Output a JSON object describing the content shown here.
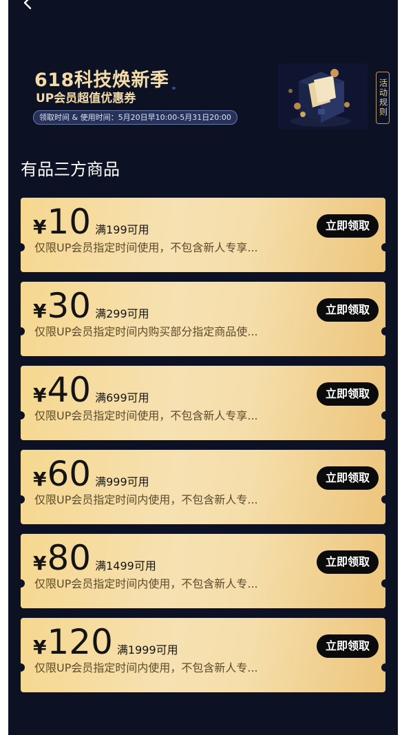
{
  "banner": {
    "title": "618科技焕新季",
    "subtitle": "UP会员超值优惠券",
    "time": "领取时间 & 使用时间：5月20日早10:00-5月31日20:00",
    "rules_label": "活动规则"
  },
  "section": {
    "title": "有品三方商品"
  },
  "coupons": [
    {
      "currency": "¥",
      "value": "10",
      "condition": "满199可用",
      "description": "仅限UP会员指定时间使用，不包含新人专享...",
      "button": "立即领取"
    },
    {
      "currency": "¥",
      "value": "30",
      "condition": "满299可用",
      "description": "仅限UP会员指定时间内购买部分指定商品使...",
      "button": "立即领取"
    },
    {
      "currency": "¥",
      "value": "40",
      "condition": "满699可用",
      "description": "仅限UP会员指定时间使用，不包含新人专享...",
      "button": "立即领取"
    },
    {
      "currency": "¥",
      "value": "60",
      "condition": "满999可用",
      "description": "仅限UP会员指定时间内使用，不包含新人专...",
      "button": "立即领取"
    },
    {
      "currency": "¥",
      "value": "80",
      "condition": "满1499可用",
      "description": "仅限UP会员指定时间内使用，不包含新人专...",
      "button": "立即领取"
    },
    {
      "currency": "¥",
      "value": "120",
      "condition": "满1999可用",
      "description": "仅限UP会员指定时间内使用，不包含新人专...",
      "button": "立即领取"
    }
  ],
  "icons": {
    "back": "chevron-left-icon",
    "banner_art": "gift-box-icon"
  },
  "colors": {
    "background": "#0c1123",
    "gold": "#f3dca7",
    "coupon_light": "#f6e1b2",
    "coupon_dark": "#edc57c",
    "button": "#0b0b0b"
  }
}
